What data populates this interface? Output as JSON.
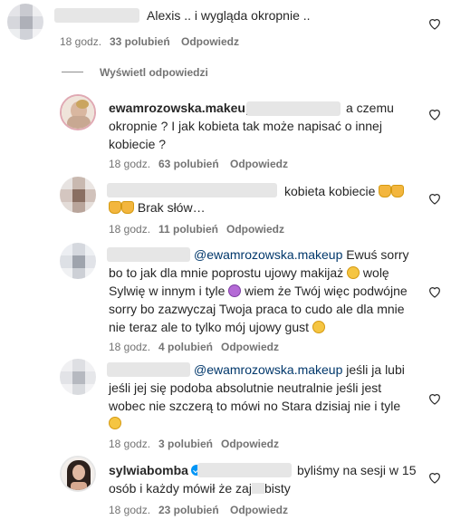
{
  "comments": [
    {
      "text": "Alexis .. i wygląda okropnie ..",
      "time": "18 godz.",
      "likes": "33 polubień",
      "reply": "Odpowiedz"
    },
    {
      "view_replies": "Wyświetl odpowiedzi"
    },
    {
      "username": "ewamrozowska.makeup",
      "text_tail_line1": "a czemu",
      "line2": "okropnie ? I jak kobieta tak może napisać o innej",
      "line3": "kobiecie ?",
      "time": "18 godz.",
      "likes": "63 polubień",
      "reply": "Odpowiedz"
    },
    {
      "text_line1": "kobieta kobiecie",
      "text_line2": "Brak słów…",
      "time": "18 godz.",
      "likes": "11 polubień",
      "reply": "Odpowiedz"
    },
    {
      "mention": "@ewamrozowska.makeup",
      "line1_tail": "Ewuś sorry",
      "line2": "bo to jak dla mnie poprostu ujowy makijaż",
      "line2_tail": "wolę",
      "line3": "Sylwię w innym i tyle",
      "line3_tail": "wiem że Twój więc podwójne",
      "line4": "sorry bo zazwyczaj Twoja praca to cudo ale dla mnie",
      "line5": "nie teraz ale to tylko mój ujowy gust",
      "time": "18 godz.",
      "likes": "4 polubień",
      "reply": "Odpowiedz"
    },
    {
      "mention": "@ewamrozowska.makeup",
      "line1_tail": "jeśli ja lubi",
      "line2": "jeśli jej się podoba absolutnie neutralnie jeśli jest",
      "line3": "wobec nie szczerą to mówi no Stara dzisiaj nie i tyle",
      "time": "18 godz.",
      "likes": "3 polubień",
      "reply": "Odpowiedz"
    },
    {
      "username": "sylwiabomba",
      "line1_tail": "byliśmy na sesji w 15",
      "line2": "osób i każdy mówił że zaj",
      "line2_tail": "bisty",
      "time": "18 godz.",
      "likes": "23 polubień",
      "reply": "Odpowiedz"
    }
  ]
}
